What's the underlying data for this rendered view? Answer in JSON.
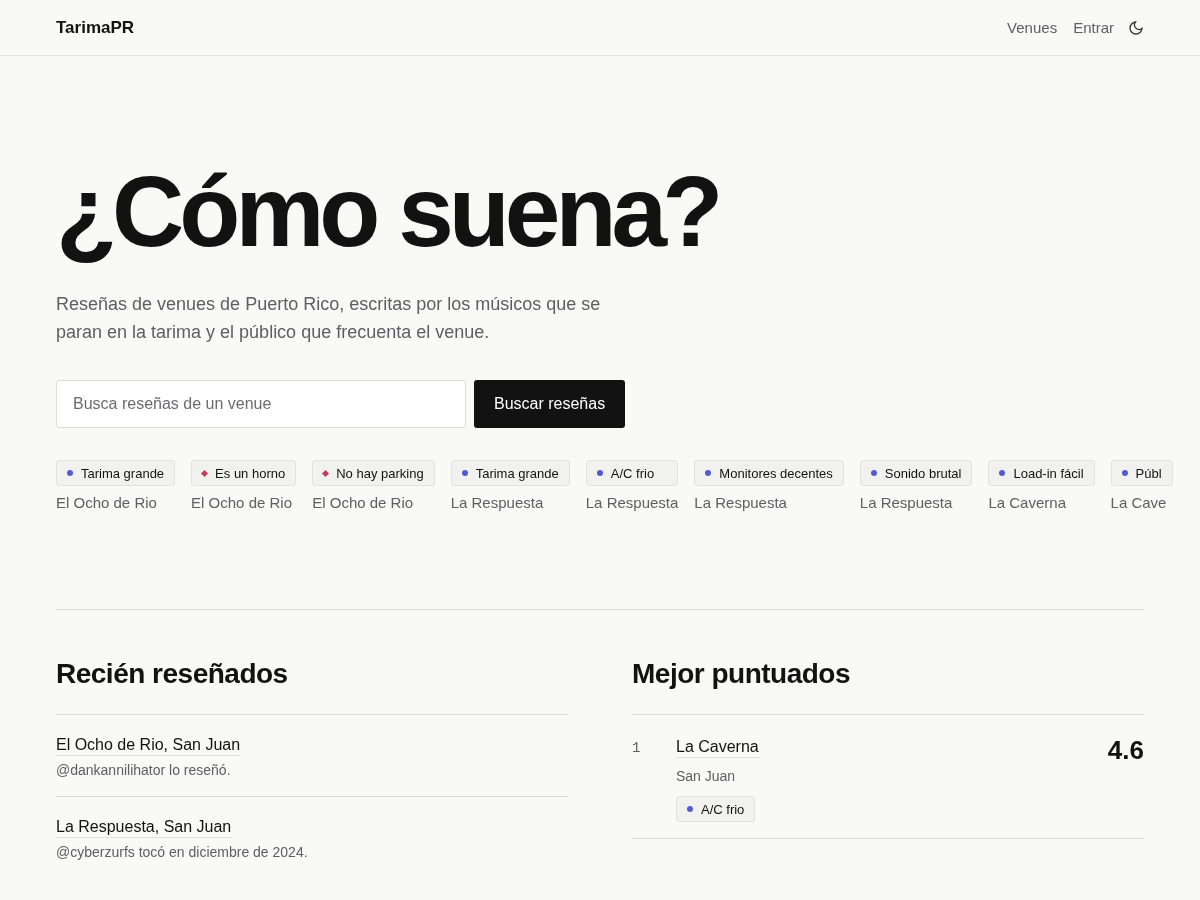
{
  "header": {
    "brand": "TarimaPR",
    "nav": [
      "Venues",
      "Entrar"
    ]
  },
  "hero": {
    "title": "¿Cómo suena?",
    "subtitle": "Reseñas de venues de Puerto Rico, escritas por los músicos que se paran en la tarima y el público que frecuenta el venue.",
    "search": {
      "placeholder": "Busca reseñas de un venue"
    },
    "button": "Buscar reseñas"
  },
  "tags": [
    {
      "label": "Tarima grande",
      "venue": "El Ocho de Rio",
      "kind": "dot",
      "color": "#4f5bd5"
    },
    {
      "label": "Es un horno",
      "venue": "El Ocho de Rio",
      "kind": "diamond",
      "color": "#c8385a"
    },
    {
      "label": "No hay parking",
      "venue": "El Ocho de Rio",
      "kind": "diamond",
      "color": "#c8385a"
    },
    {
      "label": "Tarima grande",
      "venue": "La Respuesta",
      "kind": "dot",
      "color": "#4f5bd5"
    },
    {
      "label": "A/C frio",
      "venue": "La Respuesta",
      "kind": "dot",
      "color": "#4f5bd5"
    },
    {
      "label": "Monitores decentes",
      "venue": "La Respuesta",
      "kind": "dot",
      "color": "#4f5bd5"
    },
    {
      "label": "Sonido brutal",
      "venue": "La Respuesta",
      "kind": "dot",
      "color": "#4f5bd5"
    },
    {
      "label": "Load-in fácil",
      "venue": "La Caverna",
      "kind": "dot",
      "color": "#4f5bd5"
    },
    {
      "label": "Públ",
      "venue": "La Cave",
      "kind": "dot",
      "color": "#4f5bd5"
    }
  ],
  "recent": {
    "title": "Recién reseñados",
    "items": [
      {
        "venue": "El Ocho de Rio, San Juan",
        "note": "@dankannilihator lo reseñó."
      },
      {
        "venue": "La Respuesta, San Juan",
        "note": "@cyberzurfs tocó en diciembre de 2024."
      }
    ]
  },
  "top": {
    "title": "Mejor puntuados",
    "items": [
      {
        "rank": "1",
        "venue": "La Caverna",
        "city": "San Juan",
        "score": "4.6",
        "tags": [
          {
            "label": "A/C frio",
            "kind": "dot",
            "color": "#4f5bd5"
          }
        ]
      }
    ]
  }
}
